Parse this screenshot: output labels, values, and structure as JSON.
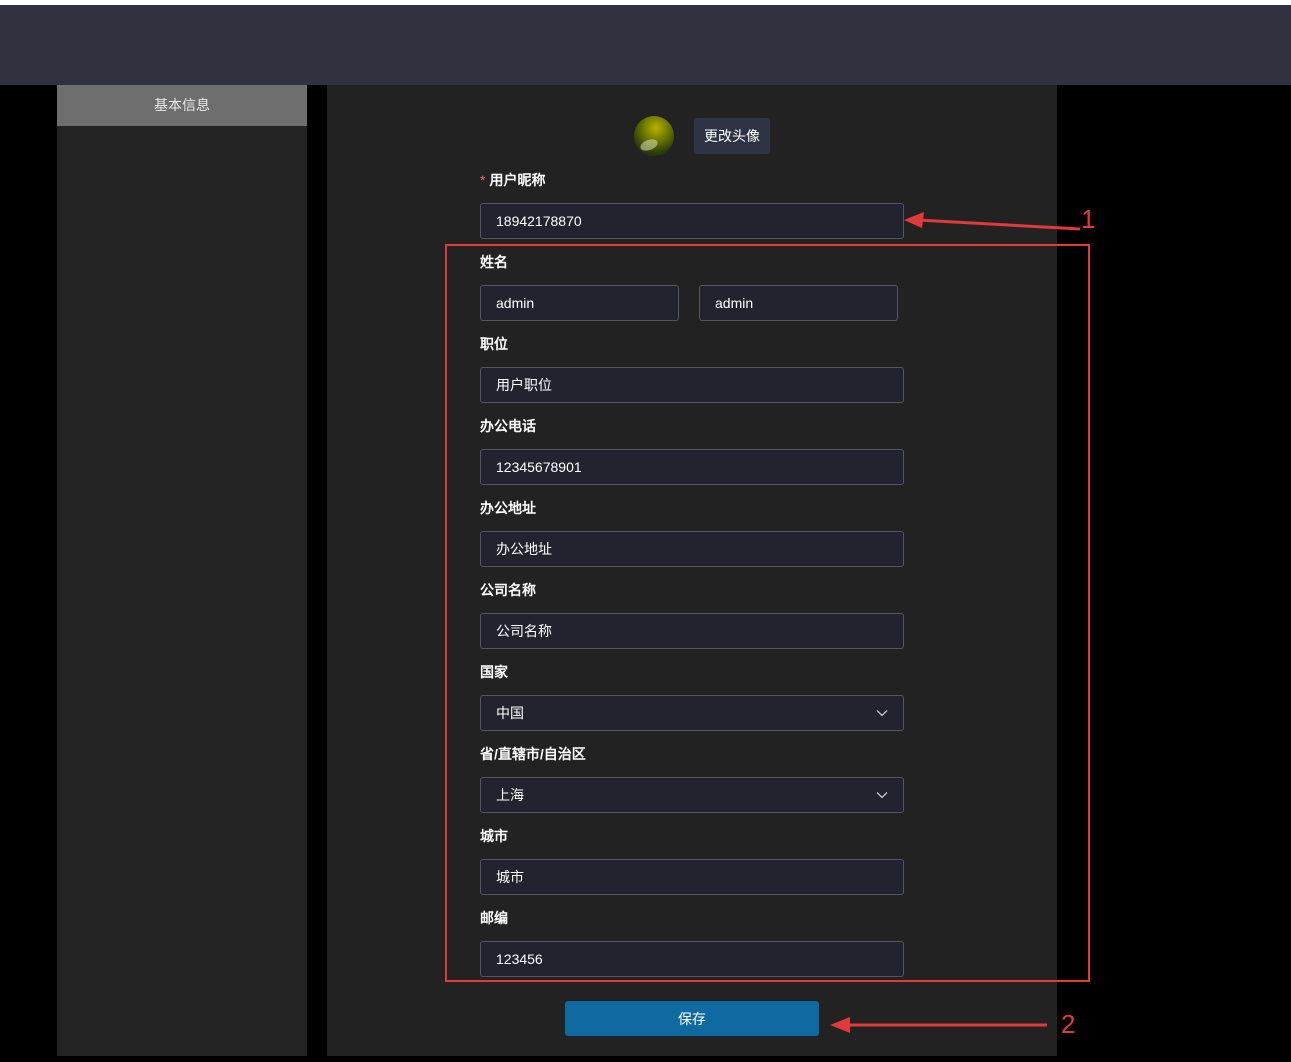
{
  "sidebar": {
    "items": [
      {
        "label": "基本信息"
      }
    ]
  },
  "profile": {
    "change_avatar_label": "更改头像"
  },
  "form": {
    "nickname": {
      "label": "用户昵称",
      "value": "18942178870",
      "required": true
    },
    "name": {
      "label": "姓名",
      "first": "admin",
      "last": "admin"
    },
    "position": {
      "label": "职位",
      "value": "用户职位"
    },
    "office_phone": {
      "label": "办公电话",
      "value": "12345678901"
    },
    "office_address": {
      "label": "办公地址",
      "value": "办公地址"
    },
    "company": {
      "label": "公司名称",
      "value": "公司名称"
    },
    "country": {
      "label": "国家",
      "value": "中国"
    },
    "province": {
      "label": "省/直辖市/自治区",
      "value": "上海"
    },
    "city": {
      "label": "城市",
      "value": "城市"
    },
    "postcode": {
      "label": "邮编",
      "value": "123456"
    },
    "save_label": "保存"
  },
  "annotations": {
    "label_1": "1",
    "label_2": "2",
    "color": "#e03a3a"
  },
  "colors": {
    "accent": "#0f6aa1",
    "topbar": "#31323f",
    "required": "#f56c6c"
  }
}
